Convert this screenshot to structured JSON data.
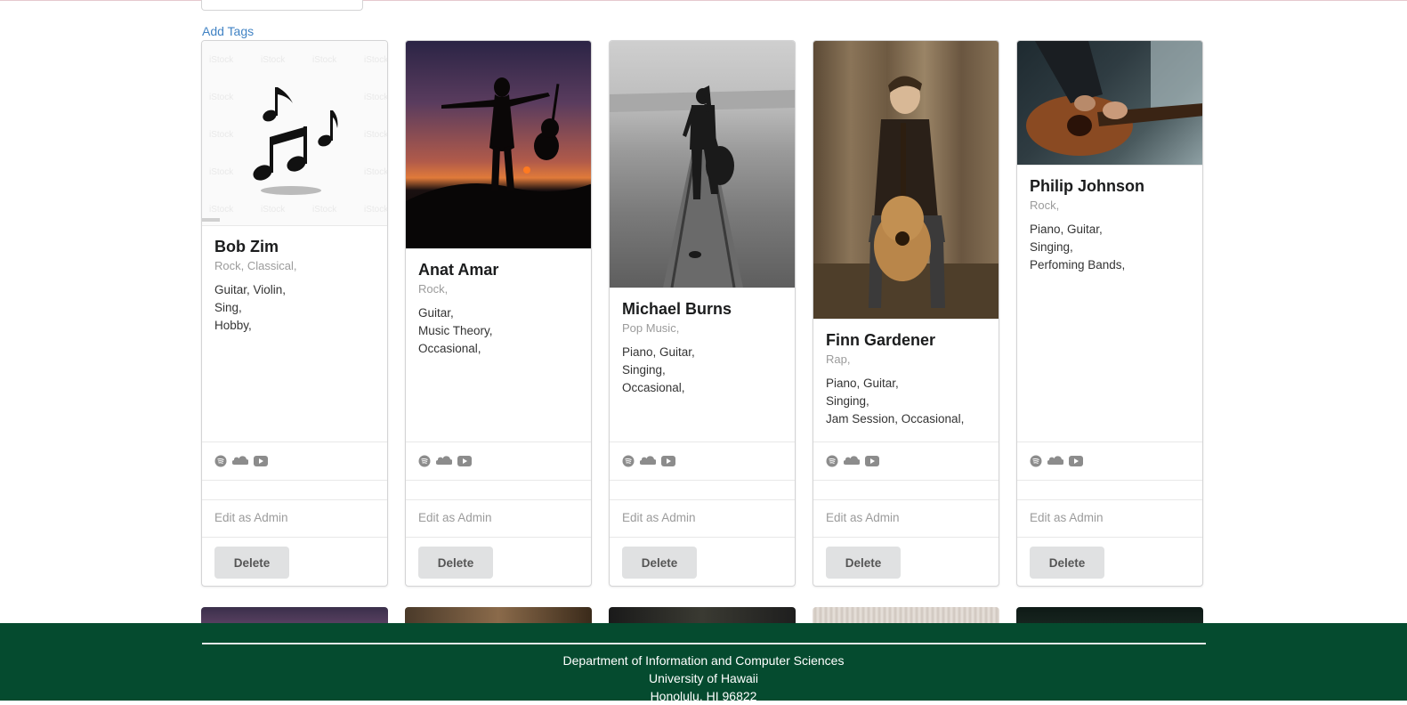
{
  "toolbar": {
    "add_tags_label": "Add Tags"
  },
  "cards": [
    {
      "name": "Bob Zim",
      "genres": "Rock, Classical,",
      "line1": "Guitar, Violin,",
      "line2": "Sing,",
      "line3": "Hobby,",
      "edit_label": "Edit as Admin",
      "delete_label": "Delete"
    },
    {
      "name": "Anat Amar",
      "genres": "Rock,",
      "line1": "Guitar,",
      "line2": "Music Theory,",
      "line3": "Occasional,",
      "edit_label": "Edit as Admin",
      "delete_label": "Delete"
    },
    {
      "name": "Michael Burns",
      "genres": "Pop Music,",
      "line1": "Piano, Guitar,",
      "line2": "Singing,",
      "line3": "Occasional,",
      "edit_label": "Edit as Admin",
      "delete_label": "Delete"
    },
    {
      "name": "Finn Gardener",
      "genres": "Rap,",
      "line1": "Piano, Guitar,",
      "line2": "Singing,",
      "line3": "Jam Session, Occasional,",
      "edit_label": "Edit as Admin",
      "delete_label": "Delete"
    },
    {
      "name": "Philip Johnson",
      "genres": "Rock,",
      "line1": "Piano, Guitar,",
      "line2": "Singing,",
      "line3": "Perfoming Bands,",
      "edit_label": "Edit as Admin",
      "delete_label": "Delete"
    }
  ],
  "social_icons": [
    "spotify-icon",
    "soundcloud-icon",
    "youtube-icon"
  ],
  "footer": {
    "line1": "Department of Information and Computer Sciences",
    "line2": "University of Hawaii",
    "line3": "Honolulu, HI 96822"
  },
  "colors": {
    "footer_bg": "#054b2f",
    "link": "#4183c4",
    "button_bg": "#e0e1e2"
  }
}
